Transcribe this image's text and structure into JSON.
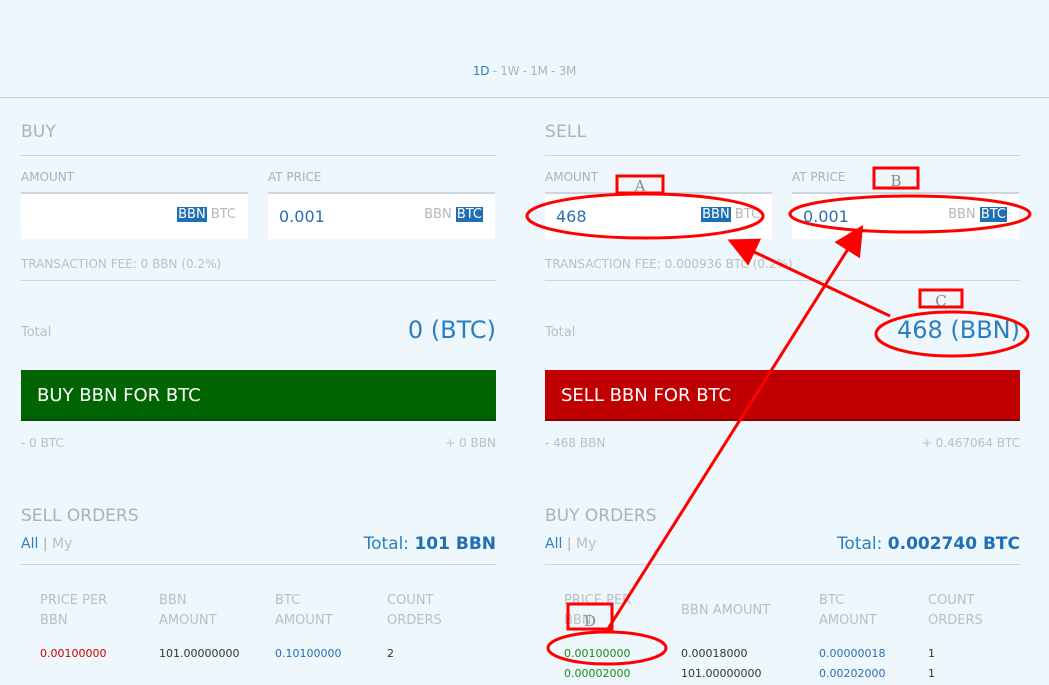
{
  "ranges": [
    "1D",
    "1W",
    "1M",
    "3M"
  ],
  "range_sep": " - ",
  "buy": {
    "title": "BUY",
    "amount_label": "AMOUNT",
    "amount_value": "",
    "amount_cur_selected": "BBN",
    "amount_cur_other": "BTC",
    "price_label": "AT PRICE",
    "price_value": "0.001",
    "price_cur_other": "BBN",
    "price_cur_selected": "BTC",
    "fee": "TRANSACTION FEE: 0 BBN (0.2%)",
    "total_label": "Total",
    "total_value": "0 (BTC)",
    "button": "BUY BBN FOR BTC",
    "sub_left": "- 0 BTC",
    "sub_right": "+ 0 BBN"
  },
  "sell": {
    "title": "SELL",
    "amount_label": "AMOUNT",
    "amount_value": "468",
    "amount_cur_selected": "BBN",
    "amount_cur_other": "BTC",
    "price_label": "AT PRICE",
    "price_value": "0.001",
    "price_cur_other": "BBN",
    "price_cur_selected": "BTC",
    "fee": "TRANSACTION FEE: 0.000936 BTC (0.2%)",
    "total_label": "Total",
    "total_value": "468 (BBN)",
    "button": "SELL BBN FOR BTC",
    "sub_left": "- 468 BBN",
    "sub_right": "+ 0.467064 BTC"
  },
  "sell_orders": {
    "title": "SELL ORDERS",
    "filter_all": "All",
    "filter_sep": "|",
    "filter_my": "My",
    "total_label": "Total:",
    "total_value": "101 BBN",
    "columns": [
      "PRICE PER BBN",
      "BBN AMOUNT",
      "BTC AMOUNT",
      "COUNT ORDERS"
    ],
    "rows": [
      [
        "0.00100000",
        "101.00000000",
        "0.10100000",
        "2"
      ]
    ]
  },
  "buy_orders": {
    "title": "BUY ORDERS",
    "filter_all": "All",
    "filter_sep": "|",
    "filter_my": "My",
    "total_label": "Total:",
    "total_value": "0.002740 BTC",
    "columns": [
      "PRICE PER BBN",
      "BBN AMOUNT",
      "BTC AMOUNT",
      "COUNT ORDERS"
    ],
    "rows": [
      [
        "0.00100000",
        "0.00018000",
        "0.00000018",
        "1"
      ],
      [
        "0.00002000",
        "101.00000000",
        "0.00202000",
        "1"
      ]
    ]
  },
  "annotations": {
    "a": "A",
    "b": "B",
    "c": "C",
    "d": "D"
  },
  "colors": {
    "accent": "#2b7fc0",
    "buy_green": "#006400",
    "sell_red": "#c00000",
    "annotation": "#ff0000"
  }
}
